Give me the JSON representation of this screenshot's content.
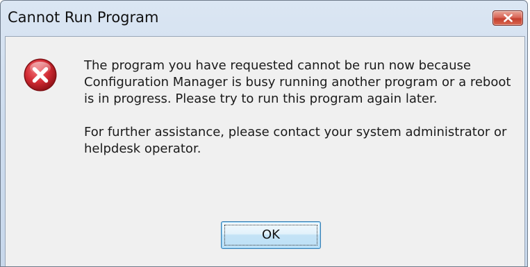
{
  "window": {
    "title": "Cannot Run Program"
  },
  "dialog": {
    "message_1": "The program you have requested cannot be run now because Configuration Manager is busy running another program or a reboot is in progress. Please try to run this program again later.",
    "message_2": "For further assistance, please contact your system administrator or helpdesk operator.",
    "ok_label": "OK",
    "icon": "error-icon"
  },
  "colors": {
    "titlebar": "#cddcee",
    "client_background": "#f0f0f0",
    "close_button": "#c4402f",
    "error_icon": "#c8252b",
    "ok_button_border": "#3c7fb1"
  }
}
